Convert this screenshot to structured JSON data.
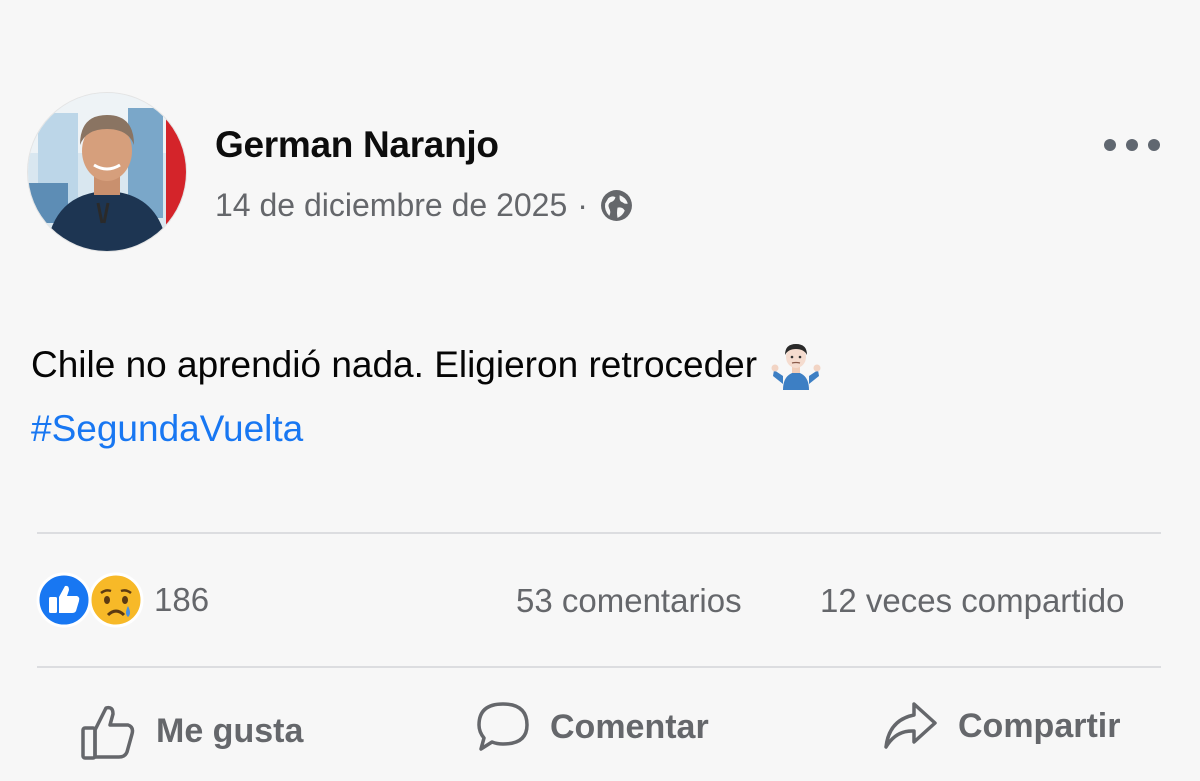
{
  "post": {
    "author": "German Naranjo",
    "date": "14 de diciembre de 2025",
    "separator": "·",
    "privacy_icon": "globe-icon",
    "text": "Chile no aprendió nada. Eligieron retroceder",
    "text_emoji": "person-shrugging-emoji",
    "hashtag": "#SegundaVuelta"
  },
  "stats": {
    "reaction_icons": [
      "like-reaction-icon",
      "sad-reaction-icon"
    ],
    "reaction_count": "186",
    "comments": "53 comentarios",
    "shares": "12 veces compartido"
  },
  "actions": {
    "like": "Me gusta",
    "comment": "Comentar",
    "share": "Compartir"
  },
  "colors": {
    "background": "#f7f7f7",
    "hashtag": "#1877f2",
    "like_blue": "#1877f2",
    "muted_text": "#65676b",
    "sad_yellow": "#f7b928"
  }
}
